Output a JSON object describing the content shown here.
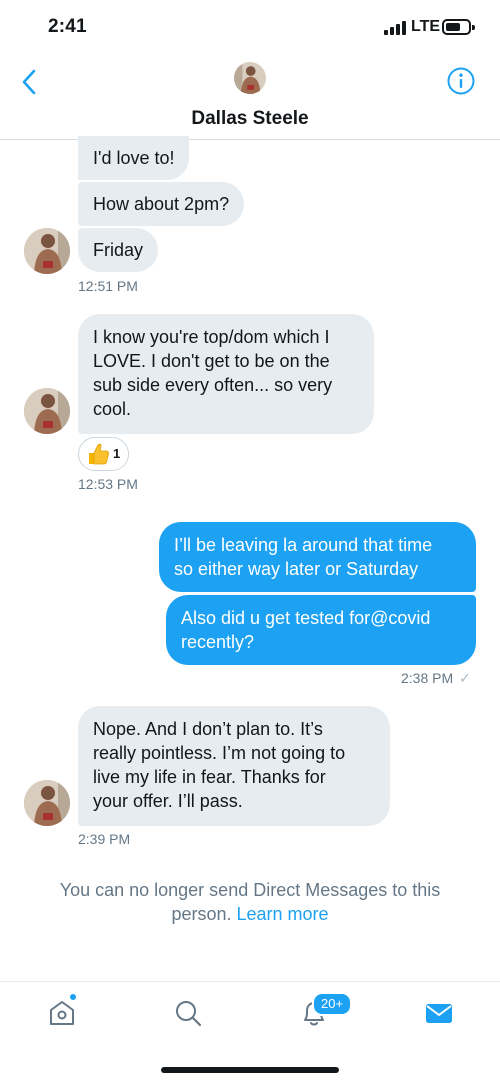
{
  "status_bar": {
    "time": "2:41",
    "network": "LTE"
  },
  "header": {
    "contact_name": "Dallas Steele",
    "icons": {
      "back": "chevron-left-icon",
      "info": "info-circle-icon"
    }
  },
  "conversation": {
    "incoming_1": [
      "I'd love to!",
      "How about 2pm?",
      "Friday"
    ],
    "incoming_1_time": "12:51 PM",
    "incoming_2": [
      "I know you're top/dom which I",
      "LOVE. I don't get to be on the",
      "sub side every often... so very",
      "cool."
    ],
    "reaction": {
      "emoji": "thumbs-up-icon",
      "count": "1"
    },
    "incoming_2_time": "12:53 PM",
    "outgoing_1": [
      "I’ll be leaving la around that time",
      "so either way later or Saturday"
    ],
    "outgoing_2": [
      "Also did u get tested for@covid",
      "recently?"
    ],
    "outgoing_time": "2:38 PM",
    "read_receipt": "✓",
    "incoming_3": [
      "Nope. And I don’t plan to. It’s",
      "really pointless. I’m not going to",
      "live my life in fear. Thanks for",
      "your offer. I’ll pass."
    ],
    "incoming_3_time": "2:39 PM"
  },
  "notice": {
    "text": "You can no longer send Direct Messages to this person. ",
    "link": "Learn more"
  },
  "tabbar": {
    "notifications_badge": "20+",
    "icons": [
      "home-icon",
      "search-icon",
      "notifications-bell-icon",
      "messages-envelope-icon"
    ]
  },
  "colors": {
    "accent": "#1da1f2",
    "incoming_bubble": "#e6ecf0",
    "secondary_text": "#657786",
    "primary_text": "#14171a"
  }
}
